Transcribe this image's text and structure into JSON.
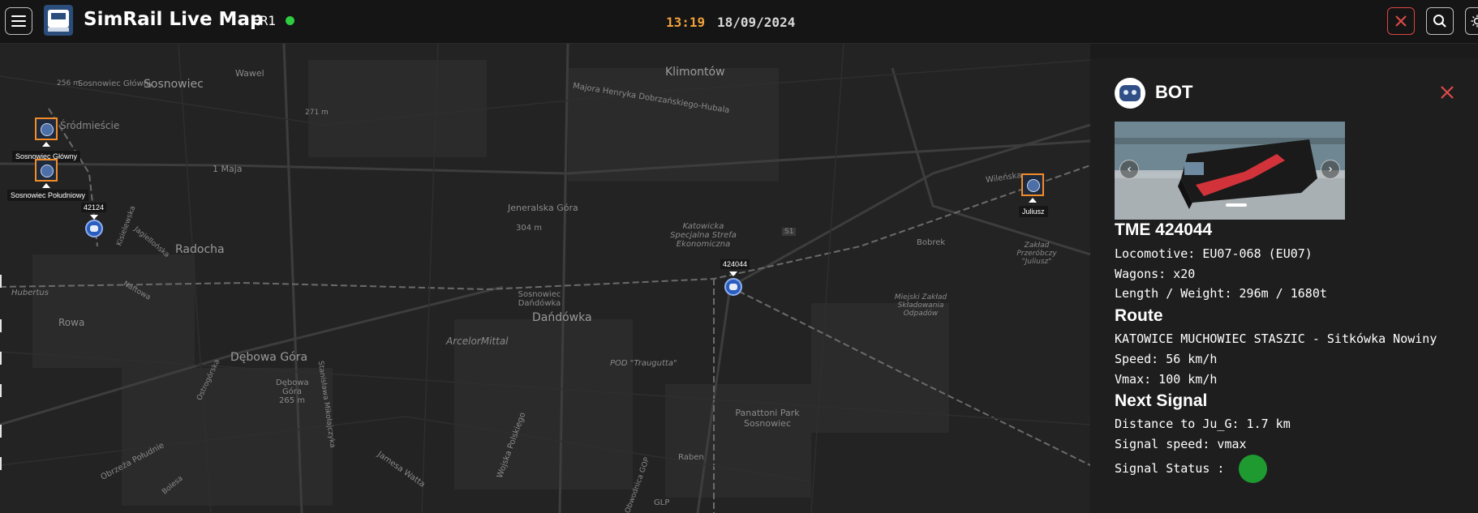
{
  "header": {
    "title": "SimRail Live Map",
    "server": "FR1",
    "server_status_color": "#2ecc40",
    "time": "13:19",
    "date": "18/09/2024",
    "icons": [
      "menu-icon",
      "logo-icon",
      "close-icon",
      "search-icon",
      "theme-toggle-icon"
    ]
  },
  "map": {
    "labels": [
      "Sosnowiec",
      "Sosnowiec Główny",
      "Klimontów",
      "Majora Henryka Dobrzańskiego-Hubala",
      "Wawel",
      "1 Maja",
      "Radocha",
      "Jeneralska Góra",
      "304 m",
      "Katowicka Specjalna Strefa Ekonomiczna",
      "Sosnowiec Dańdówka",
      "Dańdówka",
      "ArcelorMittal",
      "POD \"Traugutta\"",
      "Dębowa Góra",
      "Dębowa Góra 265 m",
      "Panattoni Park Sosnowiec",
      "Raben",
      "GLP",
      "Wileńska",
      "Bobrek",
      "Zakład Przeróbczy \"Juliusz\"",
      "Miejski Zakład Składowania Odpadów",
      "Rowa",
      "Hubertus",
      "Jamesa Watta",
      "Obrzeża Południe",
      "Wojska Polskiego",
      "Stanisława Mikołajczyka",
      "Kisielewska",
      "Jagiellońska",
      "Naftowa",
      "Ostrogórska",
      "Bolesa",
      "Obwodnica GOP",
      "S1",
      "256 m",
      "271 m",
      "Śródmieście"
    ],
    "stations": [
      {
        "name": "Sosnowiec Główny"
      },
      {
        "name": "Sosnowiec Południowy"
      },
      {
        "name": "Juliusz"
      }
    ],
    "trains": [
      {
        "number": "424044"
      },
      {
        "number": "42124"
      }
    ]
  },
  "panel": {
    "user": "BOT",
    "train_name": "TME 424044",
    "locomotive": "Locomotive: EU07-068 (EU07)",
    "wagons": "Wagons: x20",
    "length_weight": "Length / Weight: 296m / 1680t",
    "route_heading": "Route",
    "route": "KATOWICE MUCHOWIEC STASZIC - Sitkówka Nowiny",
    "speed": "Speed: 56 km/h",
    "vmax": "Vmax: 100 km/h",
    "next_signal_heading": "Next Signal",
    "distance": "Distance to Ju_G: 1.7 km",
    "signal_speed": "Signal speed: vmax",
    "signal_status_label": "Signal Status :",
    "signal_status_color": "#1e9a30",
    "prev_image": "‹",
    "next_image": "›"
  }
}
